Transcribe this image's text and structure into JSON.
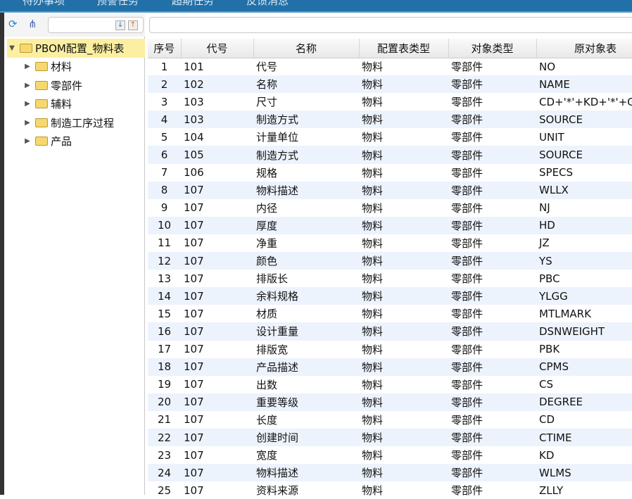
{
  "topnav": [
    "待办事项",
    "预警任务",
    "超期任务",
    "反馈消息"
  ],
  "tree": {
    "root": "PBOM配置_物料表",
    "children": [
      "材料",
      "零部件",
      "辅料",
      "制造工序过程",
      "产品"
    ]
  },
  "table": {
    "columns": [
      "序号",
      "代号",
      "名称",
      "配置表类型",
      "对象类型",
      "原对象表"
    ],
    "rows": [
      [
        "1",
        "101",
        "代号",
        "物料",
        "零部件",
        "NO"
      ],
      [
        "2",
        "102",
        "名称",
        "物料",
        "零部件",
        "NAME"
      ],
      [
        "3",
        "103",
        "尺寸",
        "物料",
        "零部件",
        "CD+'*'+KD+'*'+GD"
      ],
      [
        "4",
        "103",
        "制造方式",
        "物料",
        "零部件",
        "SOURCE"
      ],
      [
        "5",
        "104",
        "计量单位",
        "物料",
        "零部件",
        "UNIT"
      ],
      [
        "6",
        "105",
        "制造方式",
        "物料",
        "零部件",
        "SOURCE"
      ],
      [
        "7",
        "106",
        "规格",
        "物料",
        "零部件",
        "SPECS"
      ],
      [
        "8",
        "107",
        "物料描述",
        "物料",
        "零部件",
        "WLLX"
      ],
      [
        "9",
        "107",
        "内径",
        "物料",
        "零部件",
        "NJ"
      ],
      [
        "10",
        "107",
        "厚度",
        "物料",
        "零部件",
        "HD"
      ],
      [
        "11",
        "107",
        "净重",
        "物料",
        "零部件",
        "JZ"
      ],
      [
        "12",
        "107",
        "颜色",
        "物料",
        "零部件",
        "YS"
      ],
      [
        "13",
        "107",
        "排版长",
        "物料",
        "零部件",
        "PBC"
      ],
      [
        "14",
        "107",
        "余料规格",
        "物料",
        "零部件",
        "YLGG"
      ],
      [
        "15",
        "107",
        "材质",
        "物料",
        "零部件",
        "MTLMARK"
      ],
      [
        "16",
        "107",
        "设计重量",
        "物料",
        "零部件",
        "DSNWEIGHT"
      ],
      [
        "17",
        "107",
        "排版宽",
        "物料",
        "零部件",
        "PBK"
      ],
      [
        "18",
        "107",
        "产品描述",
        "物料",
        "零部件",
        "CPMS"
      ],
      [
        "19",
        "107",
        "出数",
        "物料",
        "零部件",
        "CS"
      ],
      [
        "20",
        "107",
        "重要等级",
        "物料",
        "零部件",
        "DEGREE"
      ],
      [
        "21",
        "107",
        "长度",
        "物料",
        "零部件",
        "CD"
      ],
      [
        "22",
        "107",
        "创建时间",
        "物料",
        "零部件",
        "CTIME"
      ],
      [
        "23",
        "107",
        "宽度",
        "物料",
        "零部件",
        "KD"
      ],
      [
        "24",
        "107",
        "物料描述",
        "物料",
        "零部件",
        "WLMS"
      ],
      [
        "25",
        "107",
        "资料来源",
        "物料",
        "零部件",
        "ZLLY"
      ]
    ]
  }
}
